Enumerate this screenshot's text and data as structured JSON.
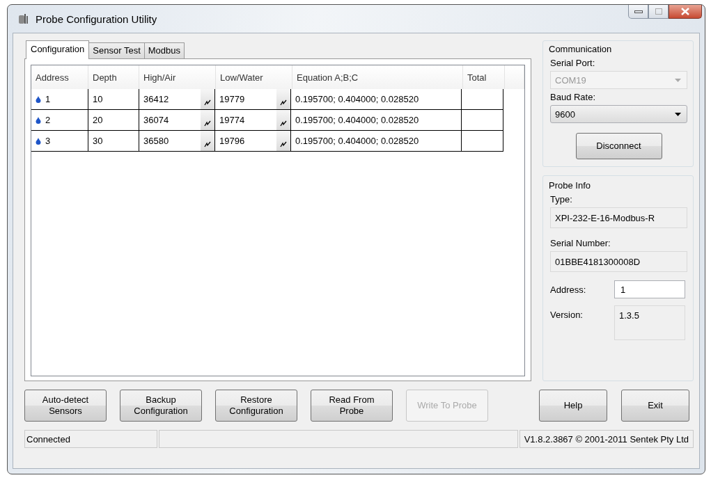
{
  "window": {
    "title": "Probe Configuration Utility"
  },
  "tabs": [
    {
      "label": "Configuration",
      "selected": true
    },
    {
      "label": "Sensor Test",
      "selected": false
    },
    {
      "label": "Modbus",
      "selected": false
    }
  ],
  "table": {
    "columns": [
      "Address",
      "Depth",
      "High/Air",
      "Low/Water",
      "Equation  A;B;C",
      "Total"
    ],
    "rows": [
      {
        "address": "1",
        "depth": "10",
        "high_air": "36412",
        "low_water": "19779",
        "equation": "0.195700; 0.404000; 0.028520"
      },
      {
        "address": "2",
        "depth": "20",
        "high_air": "36074",
        "low_water": "19774",
        "equation": "0.195700; 0.404000; 0.028520"
      },
      {
        "address": "3",
        "depth": "30",
        "high_air": "36580",
        "low_water": "19796",
        "equation": "0.195700; 0.404000; 0.028520"
      }
    ]
  },
  "communication": {
    "title": "Communication",
    "serial_port_label": "Serial Port:",
    "serial_port": {
      "value": "COM19",
      "disabled": true
    },
    "baud_rate_label": "Baud Rate:",
    "baud_rate": {
      "value": "9600",
      "disabled": false
    },
    "disconnect": "Disconnect"
  },
  "probe_info": {
    "title": "Probe Info",
    "type_label": "Type:",
    "type": "XPI-232-E-16-Modbus-R",
    "serial_label": "Serial Number:",
    "serial": "01BBE4181300008D",
    "address_label": "Address:",
    "address": "1",
    "version_label": "Version:",
    "version": "1.3.5"
  },
  "buttons": [
    {
      "label": "Auto-detect\nSensors",
      "disabled": false
    },
    {
      "label": "Backup\nConfiguration",
      "disabled": false
    },
    {
      "label": "Restore\nConfiguration",
      "disabled": false
    },
    {
      "label": "Read From\nProbe",
      "disabled": false
    },
    {
      "label": "Write To Probe",
      "disabled": true
    }
  ],
  "side_buttons": [
    {
      "label": "Help",
      "disabled": false
    },
    {
      "label": "Exit",
      "disabled": false
    }
  ],
  "status_bar": {
    "status": "Connected",
    "version": "V1.8.2.3867 © 2001-2011 Sentek Pty Ltd"
  }
}
